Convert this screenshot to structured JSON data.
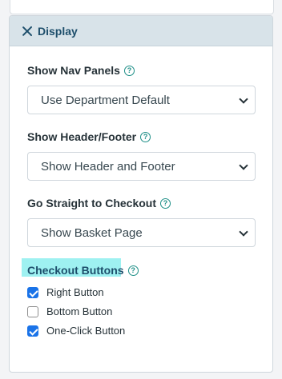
{
  "panel": {
    "title": "Display"
  },
  "fields": {
    "nav_panels": {
      "label": "Show Nav Panels",
      "value": "Use Department Default"
    },
    "header_footer": {
      "label": "Show Header/Footer",
      "value": "Show Header and Footer"
    },
    "checkout": {
      "label": "Go Straight to Checkout",
      "value": "Show Basket Page"
    }
  },
  "checkout_buttons": {
    "label": "Checkout Buttons",
    "options": [
      {
        "label": "Right Button",
        "checked": true
      },
      {
        "label": "Bottom Button",
        "checked": false
      },
      {
        "label": "One-Click Button",
        "checked": true
      }
    ]
  },
  "colors": {
    "accent": "#1d4e6b",
    "help": "#1e8f87",
    "highlight": "#9ef1f1",
    "checkbox": "#1a73e8"
  }
}
